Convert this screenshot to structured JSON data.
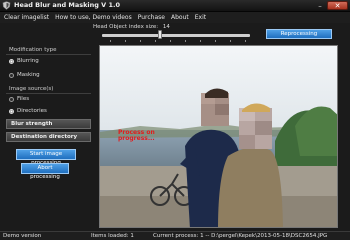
{
  "window": {
    "title": "Head Blur and Masking V 1.0",
    "minimize_glyph": "–",
    "close_glyph": "✕",
    "app_icon": "shield-app-icon"
  },
  "menu": {
    "items": [
      "Clear imagelist",
      "How to use, Demo videos",
      "Purchase",
      "About",
      "Exit"
    ]
  },
  "modification": {
    "label": "Modification type",
    "options": [
      {
        "label": "Blurring",
        "selected": true
      },
      {
        "label": "Masking",
        "selected": false
      }
    ]
  },
  "source": {
    "label": "Image source(s)",
    "options": [
      {
        "label": "Files",
        "selected": false
      },
      {
        "label": "Directories",
        "selected": true
      }
    ]
  },
  "sections": {
    "blur_strength": "Blur strength",
    "destination": "Destination directory"
  },
  "buttons": {
    "start": "Start image processing",
    "abort": "Abort processing",
    "reprocessing": "Reprocessing"
  },
  "slider": {
    "label": "Head Object index size:",
    "value": "14"
  },
  "preview": {
    "overlay_line1": "Process on",
    "overlay_line2": "progress..."
  },
  "status": {
    "left": "Demo version",
    "loaded": "Items loaded: 1",
    "current": "Current process: 1 -- D:\\pergel\\Kepek\\2013-05-18\\DSC2654.JPG"
  },
  "colors": {
    "accent_blue": "#2f86d6",
    "close_red": "#c0432f",
    "overlay_red": "#e21c1c",
    "background": "#1b1b1b"
  }
}
